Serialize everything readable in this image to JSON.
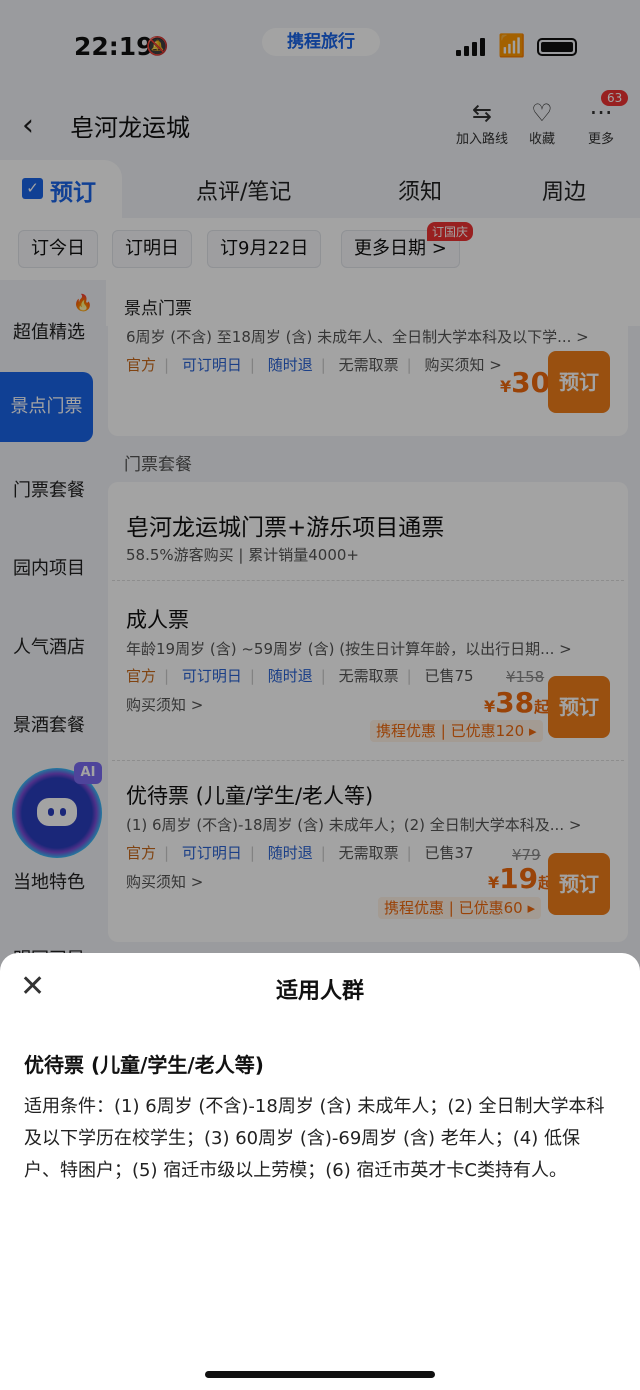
{
  "status": {
    "time": "22:19",
    "brand": "携程旅行"
  },
  "nav": {
    "title": "皂河龙运城",
    "add_route": "加入路线",
    "collect": "收藏",
    "more": "更多",
    "more_badge": "63"
  },
  "tabs": {
    "active": "预订",
    "items": [
      "点评/笔记",
      "须知",
      "周边"
    ]
  },
  "dates": {
    "today": "订今日",
    "tomorrow": "订明日",
    "sep22": "订9月22日",
    "more": "更多日期 >",
    "more_tag": "订国庆"
  },
  "sidebar": {
    "items": [
      "超值精选",
      "景点门票",
      "门票套餐",
      "园内项目",
      "人气酒店",
      "景酒套餐",
      "当地特色",
      "明园司导"
    ],
    "active_index": 1
  },
  "ai_tag": "AI",
  "section_ticket": {
    "header": "景点门票",
    "desc": "6周岁 (不含) 至18周岁 (含) 未成年人、全日制大学本科及以下学... >",
    "tags": [
      "官方",
      "可订明日",
      "随时退",
      "无需取票",
      "购买须知 >"
    ],
    "price_currency": "¥",
    "price": "30",
    "book": "预订"
  },
  "section_package": {
    "header": "门票套餐",
    "name": "皂河龙运城门票+游乐项目通票",
    "sub": "58.5%游客购买 | 累计销量4000+",
    "items": [
      {
        "name": "成人票",
        "desc": "年龄19周岁 (含) ~59周岁 (含) (按生日计算年龄，以出行日期... >",
        "tags": [
          "官方",
          "可订明日",
          "随时退",
          "无需取票",
          "已售75"
        ],
        "notice": "购买须知 >",
        "orig": "¥158",
        "price_currency": "¥",
        "price": "38",
        "price_suffix": "起",
        "discount": "携程优惠 | 已优惠120 ▸",
        "book": "预订"
      },
      {
        "name": "优待票 (儿童/学生/老人等)",
        "desc": "(1) 6周岁 (不含)-18周岁 (含) 未成年人；(2) 全日制大学本科及... >",
        "tags": [
          "官方",
          "可订明日",
          "随时退",
          "无需取票",
          "已售37"
        ],
        "notice": "购买须知 >",
        "orig": "¥79",
        "price_currency": "¥",
        "price": "19",
        "price_suffix": "起",
        "discount": "携程优惠 | 已优惠60 ▸",
        "book": "预订"
      }
    ]
  },
  "sheet": {
    "title": "适用人群",
    "product": "优待票 (儿童/学生/老人等)",
    "text": "适用条件：(1) 6周岁 (不含)-18周岁 (含) 未成年人；(2) 全日制大学本科及以下学历在校学生；(3) 60周岁 (含)-69周岁 (含) 老年人；(4) 低保户、特困户；(5) 宿迁市级以上劳模；(6) 宿迁市英才卡C类持有人。"
  }
}
